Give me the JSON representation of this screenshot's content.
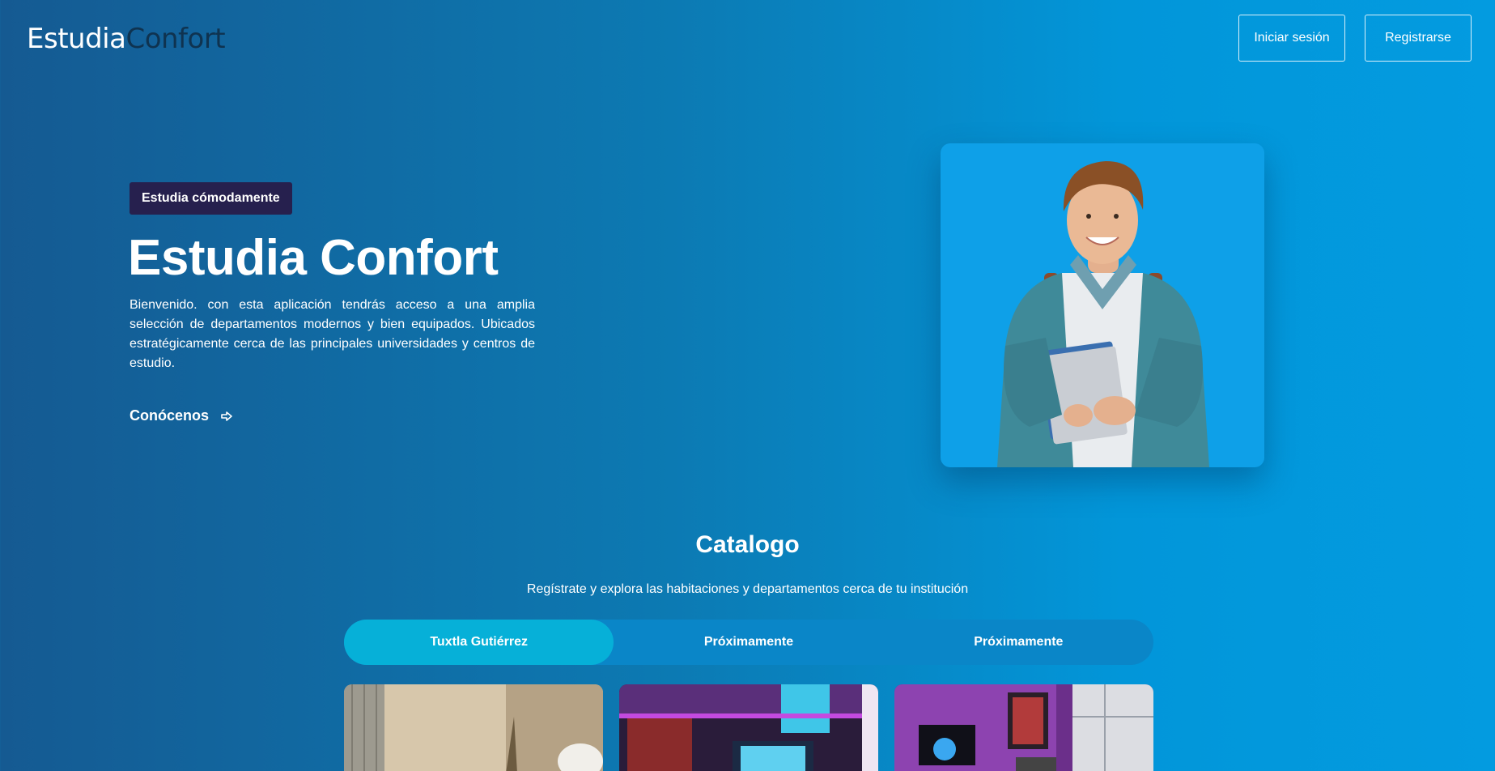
{
  "header": {
    "logo_part1": "Estudia",
    "logo_part2": "Confort",
    "login_label": "Iniciar sesión",
    "register_label": "Registrarse"
  },
  "hero": {
    "badge": "Estudia cómodamente",
    "title": "Estudia Confort",
    "description": "Bienvenido. con esta aplicación tendrás acceso a una amplia selección de departamentos modernos y bien equipados. Ubicados estratégicamente cerca de las principales universidades y centros de estudio.",
    "link_label": "Conócenos",
    "link_icon": "arrow-right-icon",
    "image_icon": "student-photo"
  },
  "catalog": {
    "title": "Catalogo",
    "subtitle": "Regístrate y explora las habitaciones y departamentos cerca de tu institución",
    "tabs": [
      {
        "label": "Tuxtla Gutiérrez",
        "active": true
      },
      {
        "label": "Próximamente",
        "active": false
      },
      {
        "label": "Próximamente",
        "active": false
      }
    ],
    "cards": [
      {
        "image": "bathroom-photo"
      },
      {
        "image": "gaming-room-photo"
      },
      {
        "image": "bedroom-photo"
      }
    ]
  },
  "colors": {
    "background_start": "#155a92",
    "background_end": "#039be0",
    "badge_bg": "#26204e",
    "logo_dark": "#0f3350",
    "tab_active": "#06b0d8",
    "tab_bar": "#0a86c8",
    "photo_bg": "#0ea0e8"
  }
}
